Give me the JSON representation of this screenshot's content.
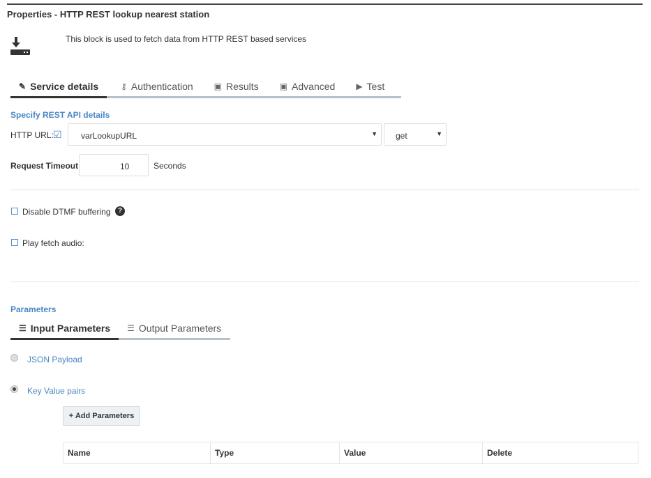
{
  "title": "Properties - HTTP REST lookup nearest station",
  "description": "This block is used to fetch data from HTTP REST based services",
  "block_icon": "download-server-icon",
  "tabs": [
    {
      "label": "Service details",
      "icon": "pencil-icon"
    },
    {
      "label": "Authentication",
      "icon": "key-icon"
    },
    {
      "label": "Results",
      "icon": "floppy-icon"
    },
    {
      "label": "Advanced",
      "icon": "floppy-icon"
    },
    {
      "label": "Test",
      "icon": "play-circle-icon"
    }
  ],
  "section_title": "Specify REST API details",
  "http_url": {
    "label": "HTTP URL:",
    "checked": true,
    "value": "varLookupURL",
    "method": "get"
  },
  "timeout": {
    "label": "Request Timeout:",
    "value": "10",
    "unit": "Seconds"
  },
  "disable_dtmf": {
    "label": "Disable DTMF buffering",
    "checked": false
  },
  "play_fetch": {
    "label": "Play fetch audio:",
    "checked": false
  },
  "parameters": {
    "title": "Parameters",
    "tabs": [
      {
        "label": "Input Parameters"
      },
      {
        "label": "Output Parameters"
      }
    ],
    "options": [
      {
        "label": "JSON Payload",
        "selected": false
      },
      {
        "label": "Key Value pairs",
        "selected": true
      }
    ],
    "add_label": "+ Add Parameters",
    "columns": [
      "Name",
      "Type",
      "Value",
      "Delete"
    ]
  },
  "colors": {
    "accent": "#4a86c5"
  }
}
